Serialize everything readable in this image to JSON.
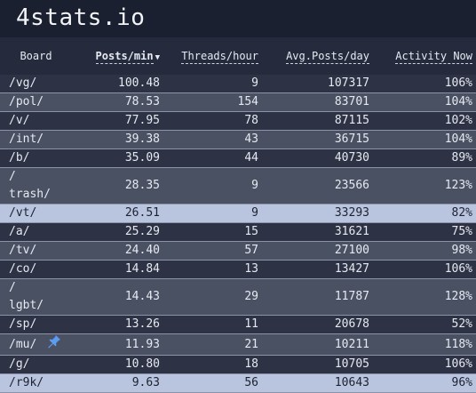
{
  "site": {
    "title": "4stats.io"
  },
  "table": {
    "headers": {
      "board": "Board",
      "posts_min": "Posts/min",
      "threads_hour": "Threads/hour",
      "avg_posts_day": "Avg.Posts/day",
      "activity_now": "Activity Now"
    },
    "sort": {
      "column": "posts_min",
      "direction": "desc"
    },
    "rows": [
      {
        "board": "/vg/",
        "posts_min": "100.48",
        "threads_hour": "9",
        "avg_posts_day": "107317",
        "activity_now": "106%"
      },
      {
        "board": "/pol/",
        "posts_min": "78.53",
        "threads_hour": "154",
        "avg_posts_day": "83701",
        "activity_now": "104%"
      },
      {
        "board": "/v/",
        "posts_min": "77.95",
        "threads_hour": "78",
        "avg_posts_day": "87115",
        "activity_now": "102%"
      },
      {
        "board": "/int/",
        "posts_min": "39.38",
        "threads_hour": "43",
        "avg_posts_day": "36715",
        "activity_now": "104%"
      },
      {
        "board": "/b/",
        "posts_min": "35.09",
        "threads_hour": "44",
        "avg_posts_day": "40730",
        "activity_now": "89%"
      },
      {
        "board": "/\ntrash/",
        "posts_min": "28.35",
        "threads_hour": "9",
        "avg_posts_day": "23566",
        "activity_now": "123%"
      },
      {
        "board": "/vt/",
        "posts_min": "26.51",
        "threads_hour": "9",
        "avg_posts_day": "33293",
        "activity_now": "82%"
      },
      {
        "board": "/a/",
        "posts_min": "25.29",
        "threads_hour": "15",
        "avg_posts_day": "31621",
        "activity_now": "75%"
      },
      {
        "board": "/tv/",
        "posts_min": "24.40",
        "threads_hour": "57",
        "avg_posts_day": "27100",
        "activity_now": "98%"
      },
      {
        "board": "/co/",
        "posts_min": "14.84",
        "threads_hour": "13",
        "avg_posts_day": "13427",
        "activity_now": "106%"
      },
      {
        "board": "/\nlgbt/",
        "posts_min": "14.43",
        "threads_hour": "29",
        "avg_posts_day": "11787",
        "activity_now": "128%"
      },
      {
        "board": "/sp/",
        "posts_min": "13.26",
        "threads_hour": "11",
        "avg_posts_day": "20678",
        "activity_now": "52%"
      },
      {
        "board": "/mu/",
        "posts_min": "11.93",
        "threads_hour": "21",
        "avg_posts_day": "10211",
        "activity_now": "118%",
        "pinned": true
      },
      {
        "board": "/g/",
        "posts_min": "10.80",
        "threads_hour": "18",
        "avg_posts_day": "10705",
        "activity_now": "106%"
      },
      {
        "board": "/r9k/",
        "posts_min": "9.63",
        "threads_hour": "56",
        "avg_posts_day": "10643",
        "activity_now": "96%"
      }
    ]
  },
  "colors": {
    "background": "#1b2030",
    "row_dark": "#2d3345",
    "row_light": "#4a5163",
    "row_highlight": "#b9c4df",
    "pin": "#5b9bf0"
  },
  "icons": {
    "pin": "pin-icon",
    "sort_caret": "caret-down-icon"
  }
}
